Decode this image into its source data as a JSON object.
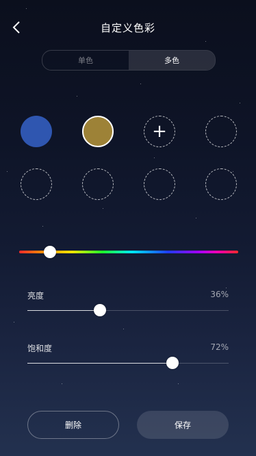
{
  "header": {
    "title": "自定义色彩",
    "back_icon": "chevron-left-icon"
  },
  "mode_tabs": [
    {
      "label": "单色",
      "active": false
    },
    {
      "label": "多色",
      "active": true
    }
  ],
  "swatches": [
    {
      "color": "#2f56b0",
      "state": "filled"
    },
    {
      "color": "#9d8237",
      "state": "selected"
    },
    {
      "state": "add",
      "icon": "plus-icon"
    },
    {
      "state": "empty"
    },
    {
      "state": "empty"
    },
    {
      "state": "empty"
    },
    {
      "state": "empty"
    },
    {
      "state": "empty"
    }
  ],
  "hue": {
    "value_fraction": 0.14
  },
  "brightness": {
    "label": "亮度",
    "value_text": "36%",
    "value": 0.36
  },
  "saturation": {
    "label": "饱和度",
    "value_text": "72%",
    "value": 0.72
  },
  "actions": {
    "delete_label": "删除",
    "save_label": "保存"
  }
}
